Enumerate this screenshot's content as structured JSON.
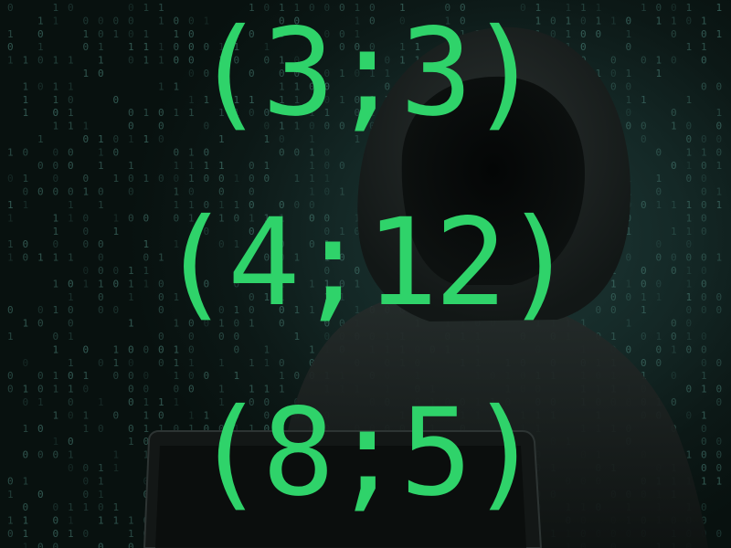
{
  "coordinates": [
    {
      "text": "(3;3)"
    },
    {
      "text": "(4;12)"
    },
    {
      "text": "(8;5)"
    }
  ],
  "colors": {
    "accent": "#2fd36a",
    "binary_dim": "#3f6e66",
    "background": "#0b1412"
  },
  "scene": {
    "subject": "hooded figure",
    "device": "laptop",
    "overlay": "binary digits"
  }
}
